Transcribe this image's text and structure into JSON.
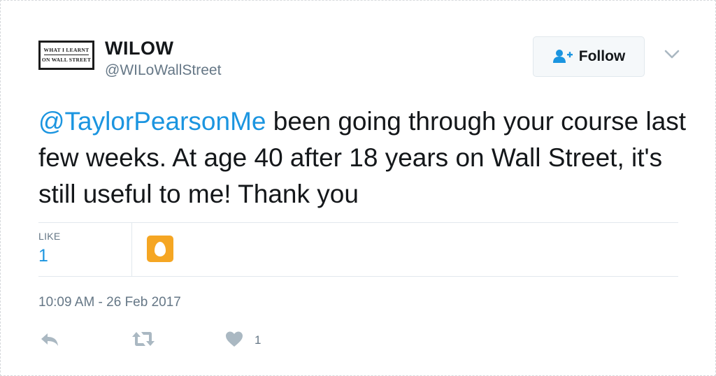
{
  "author": {
    "avatar_text": [
      "WHAT I LEARNT",
      "ON WALL STREET"
    ],
    "name": "WILOW",
    "handle": "@WILoWallStreet"
  },
  "follow_button": {
    "label": "Follow",
    "icon": "add-user-icon"
  },
  "menu_icon": "chevron-down-icon",
  "tweet": {
    "mention": "@TaylorPearsonMe",
    "text": " been going through your course last few weeks. At age 40 after 18 years on Wall Street, it's still useful to me! Thank you"
  },
  "stats": {
    "like_label": "LIKE",
    "like_count": "1",
    "liker_avatar": "egg-icon"
  },
  "timestamp": "10:09 AM - 26 Feb 2017",
  "actions": {
    "reply_icon": "reply-icon",
    "retweet_icon": "retweet-icon",
    "like_icon": "heart-icon",
    "like_count": "1"
  },
  "colors": {
    "link": "#1b95e0",
    "secondary_text": "#657786",
    "primary_text": "#14171a",
    "border": "#e1e8ed",
    "egg_avatar": "#f5a623",
    "icon": "#aab8c2"
  }
}
